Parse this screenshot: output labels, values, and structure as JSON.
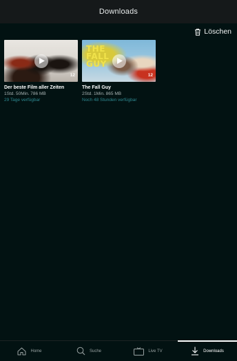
{
  "header": {
    "title": "Downloads"
  },
  "toolbar": {
    "delete_label": "Löschen",
    "delete_icon": "trash-icon"
  },
  "downloads": [
    {
      "title": "Der beste Film aller Zeiten",
      "info": "1Std. 50Min. 786 MB",
      "availability": "29 Tage verfügbar",
      "age_rating": "12",
      "art_title": ""
    },
    {
      "title": "The Fall Guy",
      "info": "2Std. 1Min. 865 MB",
      "availability": "Noch 48 Stunden verfügbar",
      "age_rating": "12",
      "art_title_line1": "THE",
      "art_title_line2": "FALL",
      "art_title_line3": "GUY"
    }
  ],
  "bottom_nav": {
    "active": "Downloads",
    "items": [
      {
        "label": "Home",
        "icon": "home-icon"
      },
      {
        "label": "Suche",
        "icon": "search-icon"
      },
      {
        "label": "Live TV",
        "icon": "tv-icon"
      },
      {
        "label": "Downloads",
        "icon": "download-icon"
      }
    ]
  },
  "colors": {
    "background": "#021212",
    "header": "#15191a",
    "accent_teal": "#2e8a92",
    "muted_text": "#a9b4b4"
  }
}
